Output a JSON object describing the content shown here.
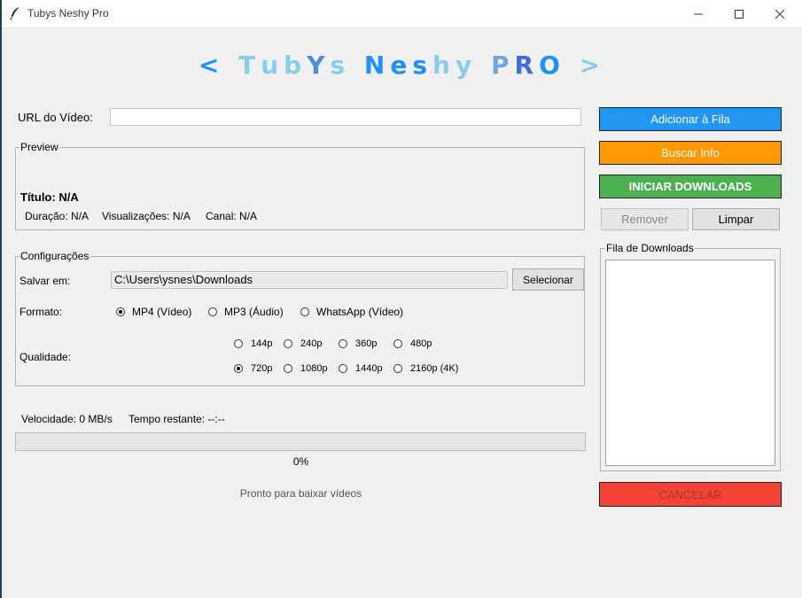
{
  "window": {
    "title": "Tubys Neshy Pro",
    "controls": {
      "minimize": "─",
      "maximize": "☐",
      "close": "✕"
    }
  },
  "banner": {
    "glyphs": [
      {
        "t": "<",
        "c": "#1e90ff"
      },
      {
        "t": " ",
        "c": "#000000"
      },
      {
        "t": "T",
        "c": "#87ceeb"
      },
      {
        "t": "u",
        "c": "#87ceeb"
      },
      {
        "t": "b",
        "c": "#87ceeb"
      },
      {
        "t": "Y",
        "c": "#4a8fd8"
      },
      {
        "t": "s",
        "c": "#87ceeb"
      },
      {
        "t": " ",
        "c": "#000000"
      },
      {
        "t": "N",
        "c": "#1e90ff"
      },
      {
        "t": "e",
        "c": "#1e90ff"
      },
      {
        "t": "s",
        "c": "#1e90ff"
      },
      {
        "t": "h",
        "c": "#87ceeb"
      },
      {
        "t": "y",
        "c": "#87ceeb"
      },
      {
        "t": " ",
        "c": "#000000"
      },
      {
        "t": "P",
        "c": "#6fa8dc"
      },
      {
        "t": "R",
        "c": "#4169e1"
      },
      {
        "t": "O",
        "c": "#1e90ff"
      },
      {
        "t": " ",
        "c": "#000000"
      },
      {
        "t": ">",
        "c": "#87ceeb"
      }
    ]
  },
  "url": {
    "label": "URL do Vídeo:",
    "value": ""
  },
  "preview": {
    "title": "Preview",
    "video_title": "Título: N/A",
    "duration": "Duração: N/A",
    "views": "Visualizações: N/A",
    "channel": "Canal: N/A"
  },
  "config": {
    "title": "Configurações",
    "save_label": "Salvar em:",
    "save_path": "C:\\Users\\ysnes\\Downloads",
    "select_button": "Selecionar",
    "format_label": "Formato:",
    "formats": [
      "MP4 (Vídeo)",
      "MP3 (Áudio)",
      "WhatsApp (Vídeo)"
    ],
    "selected_format": "MP4 (Vídeo)",
    "quality_label": "Qualidade:",
    "qualities_row1": [
      "144p",
      "240p",
      "360p",
      "480p"
    ],
    "qualities_row2": [
      "720p",
      "1080p",
      "1440p",
      "2160p (4K)"
    ],
    "selected_quality": "720p"
  },
  "stats": {
    "speed": "Velocidade: 0 MB/s",
    "remaining": "Tempo restante: --:--"
  },
  "progress": {
    "value": 0,
    "label": "0%"
  },
  "status": "Pronto para baixar vídeos",
  "actions": {
    "add_queue": "Adicionar à Fila",
    "fetch_info": "Buscar Info",
    "start": "INICIAR DOWNLOADS",
    "remove": "Remover",
    "clear": "Limpar",
    "cancel": "CANCELAR"
  },
  "queue": {
    "title": "Fila de Downloads",
    "items": []
  },
  "colors": {
    "add_queue": "#2196f3",
    "fetch_info": "#ff9800",
    "start": "#4caf50",
    "cancel": "#f44336",
    "cancel_text": "#a33a30"
  }
}
